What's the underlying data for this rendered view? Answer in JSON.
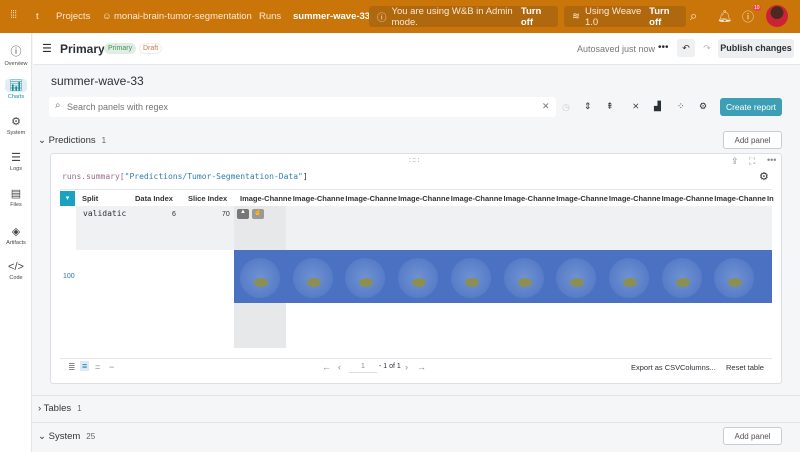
{
  "topbar": {
    "breadcrumb": [
      "t",
      "Projects",
      "monai-brain-tumor-segmentation",
      "Runs",
      "summer-wave-33"
    ],
    "admin_notice": "You are using W&B in Admin mode.",
    "admin_turn_off": "Turn off",
    "weave_notice": "Using Weave 1.0",
    "weave_turn_off": "Turn off",
    "help_badge": "10"
  },
  "sidebar": {
    "items": [
      {
        "label": "Overview",
        "icon": "info-icon"
      },
      {
        "label": "Charts",
        "icon": "chart-icon",
        "active": true
      },
      {
        "label": "System",
        "icon": "cpu-icon"
      },
      {
        "label": "Logs",
        "icon": "list-icon"
      },
      {
        "label": "Files",
        "icon": "file-icon"
      },
      {
        "label": "Artifacts",
        "icon": "layers-icon"
      },
      {
        "label": "Code",
        "icon": "code-icon"
      }
    ]
  },
  "header": {
    "title": "Primary",
    "badge_primary": "Primary",
    "badge_draft": "Draft",
    "autosave": "Autosaved just now",
    "publish": "Publish changes"
  },
  "main": {
    "run_name": "summer-wave-33",
    "search_placeholder": "Search panels with regex",
    "create_report": "Create report"
  },
  "sections": [
    {
      "name": "Predictions",
      "count": "1",
      "add_panel": "Add panel"
    },
    {
      "name": "Tables",
      "count": "1"
    },
    {
      "name": "System",
      "count": "25",
      "add_panel": "Add panel"
    }
  ],
  "table": {
    "query_prefix": "runs.summary[",
    "query_key": "\"Predictions/Tumor-Segmentation-Data\"",
    "query_suffix": "]",
    "columns": [
      "Split",
      "Data Index",
      "Slice Index",
      "Image-Channe",
      "Image-Channe",
      "Image-Channe",
      "Image-Channe",
      "Image-Channe",
      "Image-Channe",
      "Image-Channe",
      "Image-Channe",
      "Image-Channe",
      "Image-Channe",
      "In"
    ],
    "row": {
      "split": "validatic",
      "data_index": "6",
      "slice_index": "70"
    },
    "row_label": "100",
    "page": "1",
    "page_of": "- 1 of 1",
    "export": "Export as CSV",
    "columns_btn": "Columns...",
    "reset": "Reset table"
  },
  "colors": {
    "topbar": "#c97509",
    "accent": "#1a8aa2",
    "selection": "#4b71c3"
  }
}
